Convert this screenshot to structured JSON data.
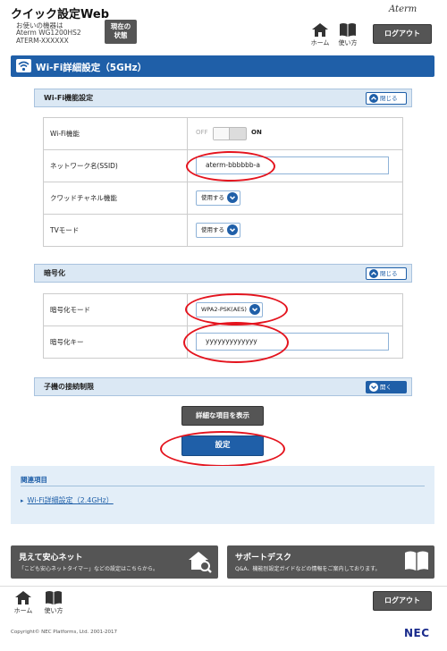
{
  "header": {
    "app_title": "クイック設定Web",
    "device_label": "お使いの機器は",
    "device_model": "Aterm WG1200HS2",
    "device_name": "ATERM-XXXXXX",
    "status_line1": "現在の",
    "status_line2": "状態",
    "home_label": "ホーム",
    "usage_label": "使い方",
    "brand": "Aterm",
    "logout_label": "ログアウト"
  },
  "page": {
    "title": "Wi-Fi詳細設定（5GHz）"
  },
  "sections": {
    "wifi": {
      "title": "Wi-Fi機能設定",
      "toggle_label": "閉じる",
      "rows": {
        "wifi_func_label": "Wi-Fi機能",
        "wifi_off": "OFF",
        "wifi_on": "ON",
        "ssid_label": "ネットワーク名(SSID)",
        "ssid_value": "aterm-bbbbbb-a",
        "quad_label": "クワッドチャネル機能",
        "quad_value": "使用する",
        "tv_label": "TVモード",
        "tv_value": "使用する"
      }
    },
    "enc": {
      "title": "暗号化",
      "toggle_label": "閉じる",
      "rows": {
        "mode_label": "暗号化モード",
        "mode_value": "WPA2-PSK(AES)",
        "key_label": "暗号化キー",
        "key_value": "yyyyyyyyyyyyy"
      }
    },
    "child": {
      "title": "子機の接続制限",
      "toggle_label": "開く"
    }
  },
  "buttons": {
    "advanced_label": "詳細な項目を表示",
    "set_label": "設定"
  },
  "related": {
    "title": "関連項目",
    "link_label": "Wi-Fi詳細設定（2.4GHz）"
  },
  "promos": {
    "safety_title": "見えて安心ネット",
    "safety_sub": "「こども安心ネットタイマー」などの設定はこちらから。",
    "support_title": "サポートデスク",
    "support_sub": "Q&A、機能別設定ガイドなどの情報をご案内しております。"
  },
  "footer": {
    "home_label": "ホーム",
    "usage_label": "使い方",
    "logout_label": "ログアウト",
    "copyright": "Copyright© NEC Platforms, Ltd. 2001-2017",
    "nec": "NEC"
  },
  "colors": {
    "accent": "#1f5fa8",
    "section_bg": "#dbe8f4",
    "annotation_red": "#e4141e",
    "dark_button": "#555555"
  },
  "icons": [
    "home-icon",
    "book-icon",
    "wifi-icon",
    "chevron-up-icon",
    "chevron-down-icon",
    "house-search-icon",
    "open-book-icon"
  ]
}
